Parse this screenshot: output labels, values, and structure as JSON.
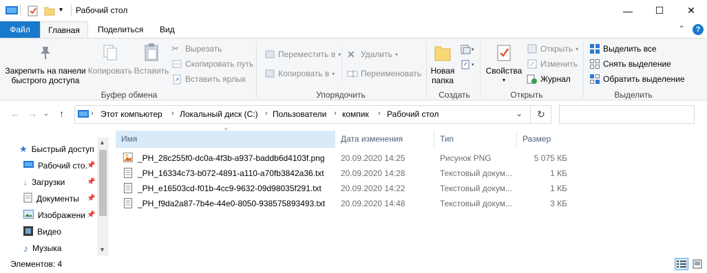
{
  "window": {
    "title": "Рабочий стол",
    "minimize_glyph": "—",
    "maximize_glyph": "☐",
    "close_glyph": "✕"
  },
  "ribbon_tabs": {
    "file": "Файл",
    "home": "Главная",
    "share": "Поделиться",
    "view": "Вид",
    "collapse_glyph": "⌃",
    "help_glyph": "?"
  },
  "clipboard": {
    "pin_label": "Закрепить на панели\nбыстрого доступа",
    "copy_label": "Копировать",
    "paste_label": "Вставить",
    "cut_label": "Вырезать",
    "copy_path_label": "Скопировать путь",
    "paste_shortcut_label": "Вставить ярлык",
    "group_label": "Буфер обмена"
  },
  "organize": {
    "move_to_label": "Переместить в",
    "copy_to_label": "Копировать в",
    "delete_label": "Удалить",
    "rename_label": "Переименовать",
    "group_label": "Упорядочить"
  },
  "create": {
    "new_folder_label": "Новая\nпапка",
    "group_label": "Создать"
  },
  "open": {
    "properties_label": "Свойства",
    "open_label": "Открыть",
    "edit_label": "Изменить",
    "history_label": "Журнал",
    "group_label": "Открыть"
  },
  "select": {
    "select_all_label": "Выделить все",
    "select_none_label": "Снять выделение",
    "invert_label": "Обратить выделение",
    "group_label": "Выделить"
  },
  "address": {
    "crumbs": [
      "Этот компьютер",
      "Локальный диск (C:)",
      "Пользователи",
      "компик",
      "Рабочий стол"
    ],
    "refresh_glyph": "↻",
    "dropdown_glyph": "⌄"
  },
  "nav_pane": {
    "items": [
      {
        "label": "Быстрый доступ",
        "icon": "star-icon"
      },
      {
        "label": "Рабочий сто.",
        "icon": "desktop-icon"
      },
      {
        "label": "Загрузки",
        "icon": "download-icon"
      },
      {
        "label": "Документы",
        "icon": "documents-icon"
      },
      {
        "label": "Изображени",
        "icon": "pictures-icon"
      },
      {
        "label": "Видео",
        "icon": "video-icon"
      },
      {
        "label": "Музыка",
        "icon": "music-icon"
      }
    ]
  },
  "columns": {
    "name": "Имя",
    "date": "Дата изменения",
    "type": "Тип",
    "size": "Размер"
  },
  "files": [
    {
      "name": "_PH_28c255f0-dc0a-4f3b-a937-baddb6d4103f.png",
      "date": "20.09.2020 14:25",
      "type": "Рисунок PNG",
      "size": "5 075 КБ",
      "icon": "image-file-icon"
    },
    {
      "name": "_PH_16334c73-b072-4891-a110-a70fb3842a36.txt",
      "date": "20.09.2020 14:28",
      "type": "Текстовый докум...",
      "size": "1 КБ",
      "icon": "text-file-icon"
    },
    {
      "name": "_PH_e16503cd-f01b-4cc9-9632-09d98035f291.txt",
      "date": "20.09.2020 14:22",
      "type": "Текстовый докум...",
      "size": "1 КБ",
      "icon": "text-file-icon"
    },
    {
      "name": "_PH_f9da2a87-7b4e-44e0-8050-938575893493.txt",
      "date": "20.09.2020 14:48",
      "type": "Текстовый докум...",
      "size": "3 КБ",
      "icon": "text-file-icon"
    }
  ],
  "status": {
    "item_count": "Элементов: 4"
  },
  "colors": {
    "accent": "#1979ca",
    "ribbon_bg": "#f5f6f7",
    "header_text": "#4c607a"
  }
}
